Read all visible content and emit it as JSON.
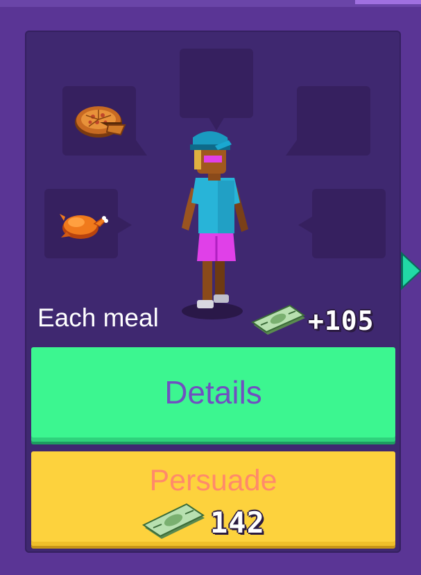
{
  "card": {
    "meal_label": "Each meal",
    "meal_reward": "+105",
    "slots": [
      {
        "position": "top-left",
        "item": "pizza-icon",
        "filled": true
      },
      {
        "position": "top-center",
        "item": "",
        "filled": false
      },
      {
        "position": "top-right",
        "item": "",
        "filled": false
      },
      {
        "position": "mid-left",
        "item": "roast-chicken-icon",
        "filled": true
      },
      {
        "position": "mid-right",
        "item": "",
        "filled": false
      }
    ]
  },
  "buttons": {
    "details_label": "Details",
    "persuade_label": "Persuade",
    "persuade_cost": "142"
  },
  "colors": {
    "details_bg": "#3cf690",
    "persuade_bg": "#fdd23d",
    "card_bg": "#3f2870",
    "arrow": "#21d9a6"
  }
}
